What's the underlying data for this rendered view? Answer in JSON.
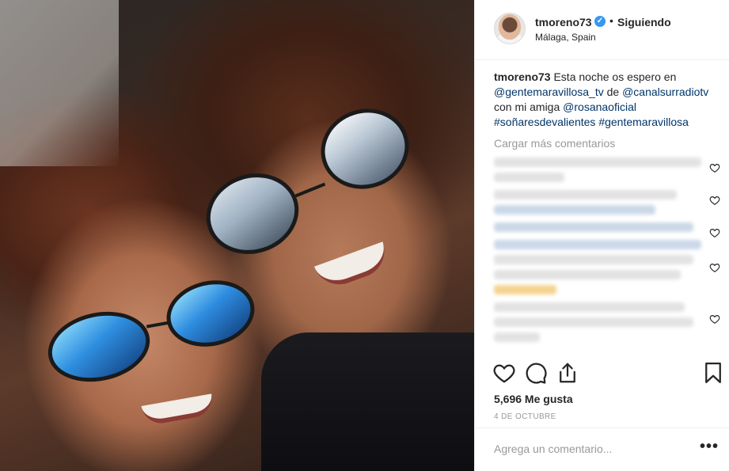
{
  "post": {
    "image_alt": "",
    "header": {
      "username": "tmoreno73",
      "separator": "•",
      "follow_status": "Siguiendo",
      "location": "Málaga, Spain"
    },
    "caption": {
      "username": "tmoreno73",
      "text_1": " Esta noche os espero en ",
      "mention_1": "@gentemaravillosa_tv",
      "text_2": " de ",
      "mention_2": "@canalsurradiotv",
      "text_3": " con mi amiga ",
      "mention_3": "@rosanaoficial",
      "hashtag_1": "#soñaresdevalientes",
      "hashtag_2": "#gentemaravillosa"
    },
    "load_more": "Cargar más comentarios",
    "likes": "5,696 Me gusta",
    "date": "4 DE OCTUBRE",
    "add_comment_placeholder": "Agrega un comentario...",
    "more_options": "•••",
    "icons": {
      "like": "heart-icon",
      "comment": "comment-icon",
      "share": "share-icon",
      "save": "bookmark-icon",
      "verified": "verified-badge-icon"
    },
    "colors": {
      "text": "#262626",
      "muted": "#999999",
      "link": "#003569",
      "verified": "#3897f0",
      "border": "#efefef"
    }
  }
}
